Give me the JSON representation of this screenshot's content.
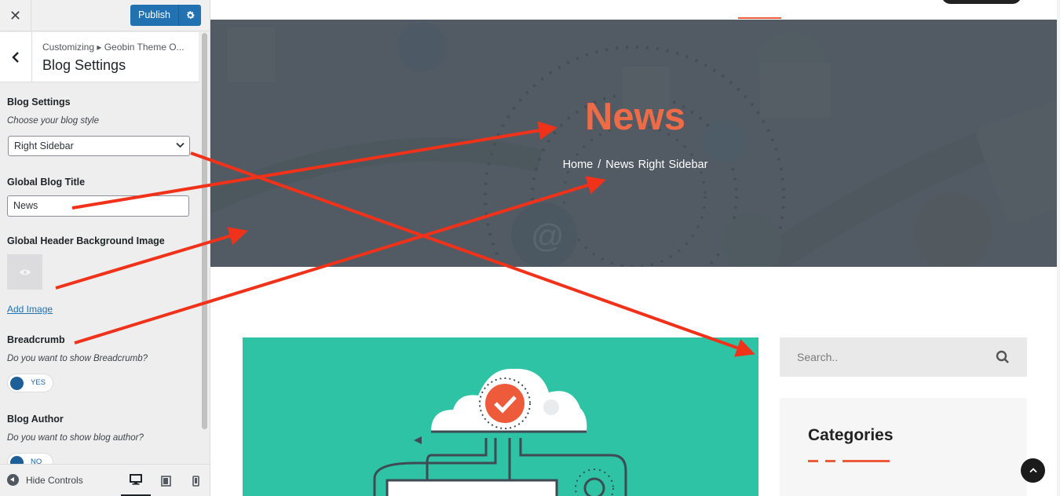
{
  "customizer": {
    "publish_label": "Publish",
    "breadcrumb": "Customizing ▸ Geobin Theme O...",
    "section_title": "Blog Settings",
    "controls": {
      "blog_settings_title": "Blog Settings",
      "blog_style_desc": "Choose your blog style",
      "blog_style_value": "Right Sidebar",
      "global_title_label": "Global Blog Title",
      "global_title_value": "News",
      "header_bg_label": "Global Header Background Image",
      "add_image": "Add Image",
      "breadcrumb_label": "Breadcrumb",
      "breadcrumb_desc": "Do you want to show Breadcrumb?",
      "breadcrumb_toggle": "YES",
      "author_label": "Blog Author",
      "author_desc": "Do you want to show blog author?",
      "author_toggle": "NO"
    },
    "footer": {
      "hide_controls": "Hide Controls"
    }
  },
  "preview": {
    "hero_title": "News",
    "hero_breadcrumb_home": "Home",
    "hero_breadcrumb_separator": "/",
    "hero_breadcrumb_current": "News Right Sidebar",
    "search_placeholder": "Search..",
    "categories_title": "Categories"
  },
  "colors": {
    "accent": "#ee5b3a",
    "publish_blue": "#2271b1",
    "annotation_arrow": "#f0321a",
    "post_teal": "#2ec3a5"
  },
  "icons": [
    "close-icon",
    "gear-icon",
    "chevron-left-icon",
    "chevron-down-icon",
    "eye-icon",
    "collapse-icon",
    "desktop-icon",
    "tablet-icon",
    "mobile-icon",
    "search-icon",
    "chevron-up-icon"
  ]
}
